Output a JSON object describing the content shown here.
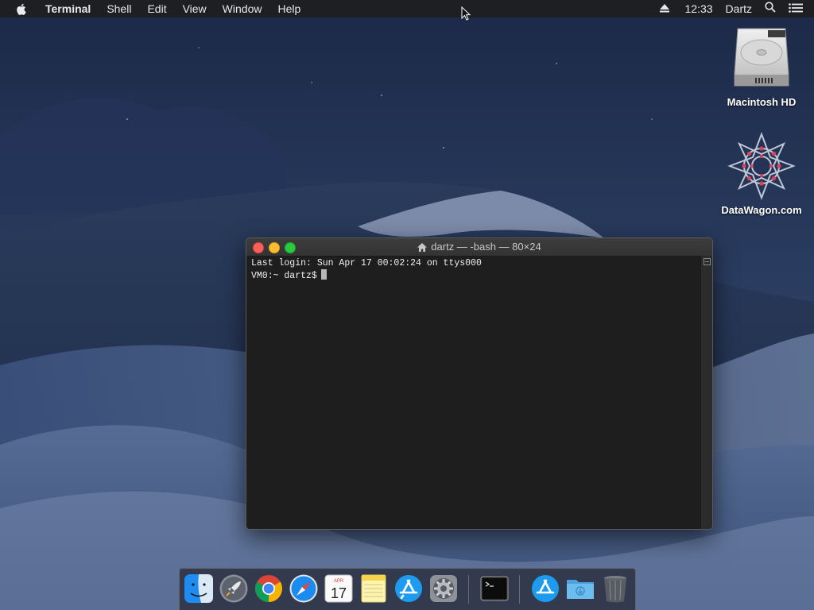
{
  "menubar": {
    "app_name": "Terminal",
    "menus": [
      "Shell",
      "Edit",
      "View",
      "Window",
      "Help"
    ],
    "clock": "12:33",
    "user": "Dartz"
  },
  "desktop_icons": [
    {
      "label": "Macintosh HD",
      "icon": "hard-drive-icon"
    },
    {
      "label": "DataWagon.com",
      "icon": "datawagon-logo-icon"
    }
  ],
  "terminal": {
    "title": "dartz — -bash — 80×24",
    "lines": [
      "Last login: Sun Apr 17 00:02:24 on ttys000",
      "VM0:~ dartz$"
    ]
  },
  "dock": {
    "items": [
      {
        "name": "finder",
        "running": true
      },
      {
        "name": "launchpad",
        "running": false
      },
      {
        "name": "chrome",
        "running": true
      },
      {
        "name": "safari",
        "running": true
      },
      {
        "name": "calendar",
        "running": false,
        "month": "APR",
        "day": "17"
      },
      {
        "name": "notes",
        "running": false
      },
      {
        "name": "app-store",
        "running": false
      },
      {
        "name": "system-preferences",
        "running": false
      },
      {
        "name": "terminal",
        "running": true
      },
      {
        "name": "app-store-downloads",
        "running": false
      },
      {
        "name": "downloads-folder",
        "running": false
      },
      {
        "name": "trash",
        "running": false
      }
    ]
  },
  "colors": {
    "close": "#fc5f57",
    "minimize": "#fdbc2e",
    "maximize": "#28c840",
    "terminal_bg": "#1e1e1e"
  }
}
